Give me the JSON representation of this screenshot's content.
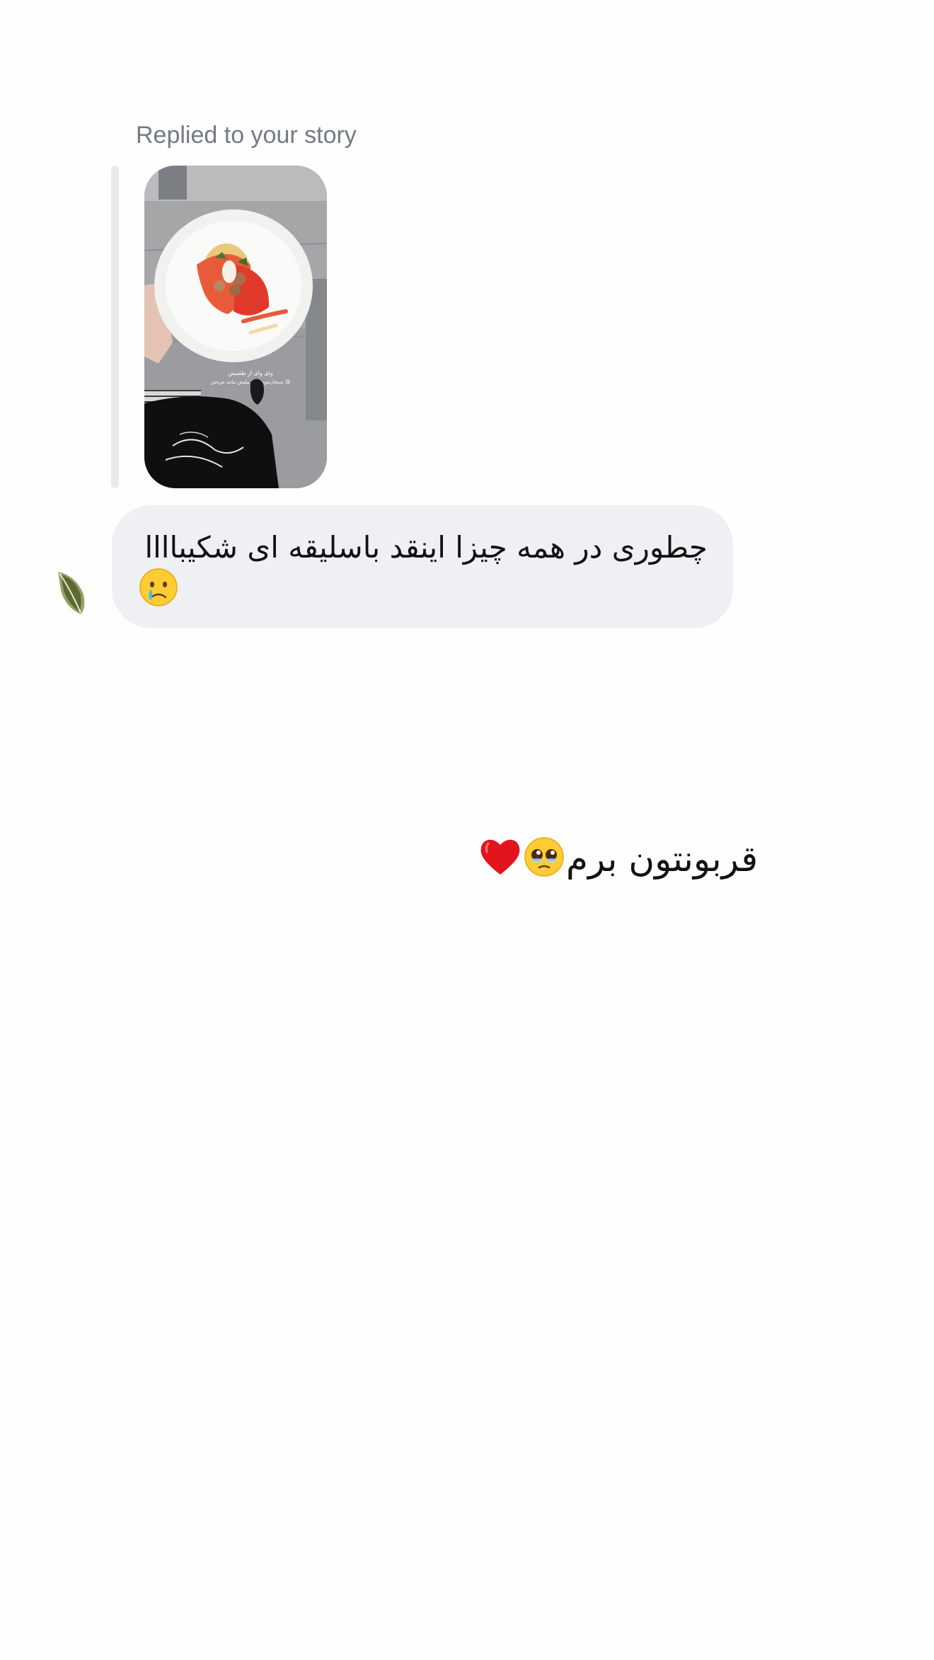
{
  "story_reply": {
    "label": "Replied to your story",
    "thumbnail": {
      "overlay_line_1": "وای وای از طعمش",
      "overlay_line_2": "سبحان‌مون دلی بیلیش نیامد مزه‌ش 😋"
    }
  },
  "incoming_message": {
    "text": "چطوری در همه چیزا اینقد باسلیقه ای شکیباااا",
    "emoji": "crying-face"
  },
  "outgoing_message": {
    "text": "قربونتون برم",
    "emojis": [
      "pleading-face",
      "red-heart"
    ]
  },
  "colors": {
    "background": "#fefefe",
    "incoming_bubble": "#eef0f3",
    "label_gray": "#737a84",
    "reply_bar": "#e8eaed"
  }
}
